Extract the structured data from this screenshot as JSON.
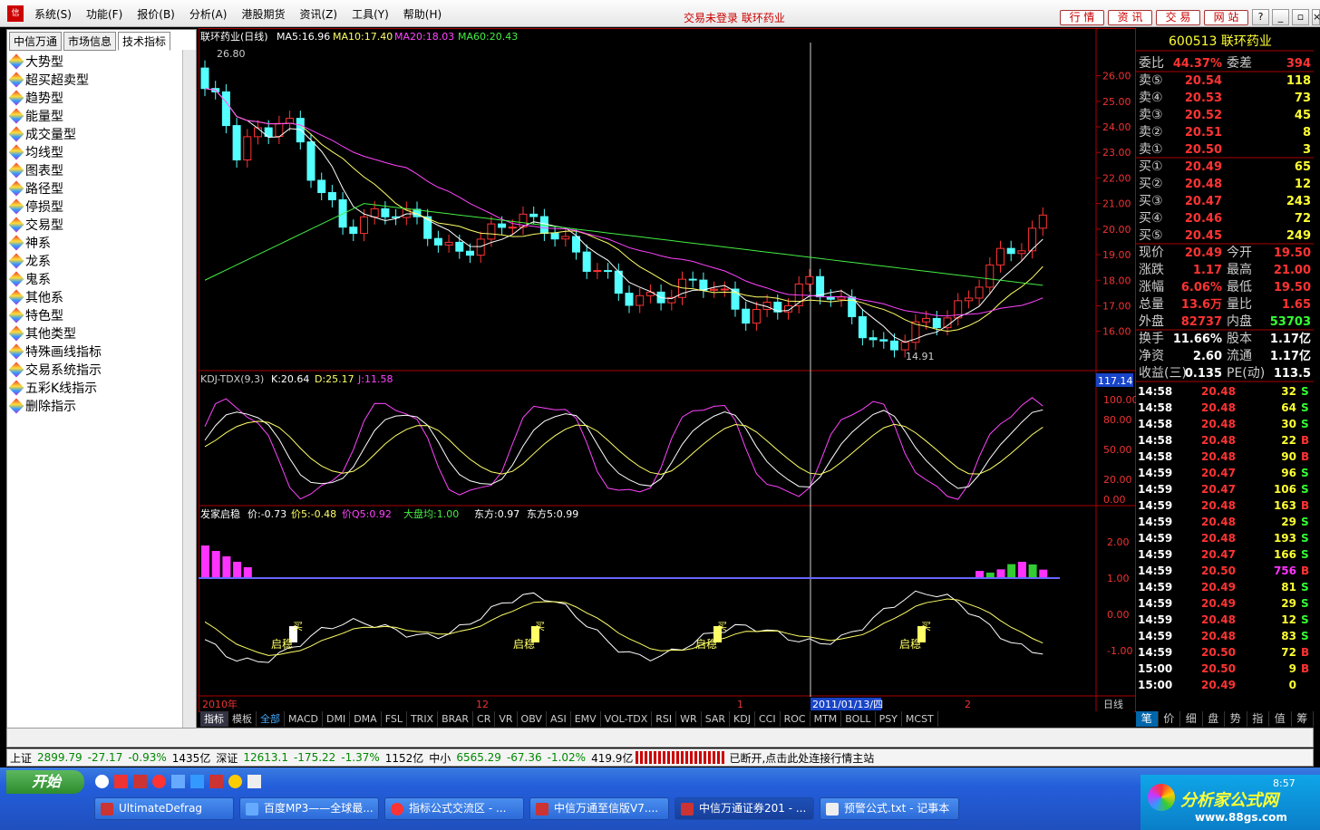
{
  "title_bar": {
    "menus": [
      "系统(S)",
      "功能(F)",
      "报价(B)",
      "分析(A)",
      "港股期货",
      "资讯(Z)",
      "工具(Y)",
      "帮助(H)"
    ],
    "status": "交易未登录",
    "stock": "联环药业",
    "nav": [
      "行 情",
      "资 讯",
      "交 易",
      "网 站"
    ],
    "win_buttons": [
      "?",
      "_",
      "▫",
      "×"
    ]
  },
  "left_panel": {
    "tabs": [
      "中信万通",
      "市场信息",
      "技术指标"
    ],
    "items": [
      "大势型",
      "超买超卖型",
      "趋势型",
      "能量型",
      "成交量型",
      "均线型",
      "图表型",
      "路径型",
      "停损型",
      "交易型",
      "神系",
      "龙系",
      "鬼系",
      "其他系",
      "特色型",
      "其他类型",
      "特殊画线指标",
      "交易系统指示",
      "五彩K线指示",
      "删除指示"
    ]
  },
  "main_chart": {
    "header": {
      "name": "联环药业(日线)",
      "ma5": "MA5:16.96",
      "ma10": "MA10:17.40",
      "ma20": "MA20:18.03",
      "ma60": "MA60:20.43"
    },
    "high_label": "26.80",
    "low_label": "14.91",
    "y_ticks": [
      "26.00",
      "25.00",
      "24.00",
      "23.00",
      "22.00",
      "21.00",
      "20.00",
      "19.00",
      "18.00",
      "17.00",
      "16.00"
    ]
  },
  "kdj": {
    "title": "KDJ-TDX(9,3)",
    "k": "K:20.64",
    "d": "D:25.17",
    "j": "J:11.58",
    "value_box": "117.14",
    "y_ticks": [
      "100.00",
      "80.00",
      "50.00",
      "20.00",
      "0.00"
    ]
  },
  "indicator": {
    "title": "发家启稳",
    "p1": "价:-0.73",
    "p2": "价5:-0.48",
    "p3": "价Q5:0.92",
    "p4": "大盘均:1.00",
    "p5": "东方:0.97",
    "p6": "东方5:0.99",
    "y_ticks": [
      "2.00",
      "1.00",
      "0.00",
      "-1.00"
    ],
    "signals": [
      "启稳",
      "启稳",
      "启稳",
      "启稳"
    ],
    "buy_labels": [
      "买",
      "买",
      "买",
      "买"
    ]
  },
  "x_axis": {
    "labels": [
      "2010年",
      "12",
      "1",
      "2011/01/13/四",
      "2"
    ],
    "period": "日线"
  },
  "bottom_tabs": [
    "指标",
    "模板",
    "全部",
    "MACD",
    "DMI",
    "DMA",
    "FSL",
    "TRIX",
    "BRAR",
    "CR",
    "VR",
    "OBV",
    "ASI",
    "EMV",
    "VOL-TDX",
    "RSI",
    "WR",
    "SAR",
    "KDJ",
    "CCI",
    "ROC",
    "MTM",
    "BOLL",
    "PSY",
    "MCST"
  ],
  "quote": {
    "code_name": "600513 联环药业",
    "webi": "委比",
    "webi_v": "44.37%",
    "weicha": "委差",
    "weicha_v": "394",
    "sell": [
      {
        "l": "卖⑤",
        "p": "20.54",
        "v": "118"
      },
      {
        "l": "卖④",
        "p": "20.53",
        "v": "73"
      },
      {
        "l": "卖③",
        "p": "20.52",
        "v": "45"
      },
      {
        "l": "卖②",
        "p": "20.51",
        "v": "8"
      },
      {
        "l": "卖①",
        "p": "20.50",
        "v": "3"
      }
    ],
    "buy": [
      {
        "l": "买①",
        "p": "20.49",
        "v": "65"
      },
      {
        "l": "买②",
        "p": "20.48",
        "v": "12"
      },
      {
        "l": "买③",
        "p": "20.47",
        "v": "243"
      },
      {
        "l": "买④",
        "p": "20.46",
        "v": "72"
      },
      {
        "l": "买⑤",
        "p": "20.45",
        "v": "249"
      }
    ],
    "stats": [
      [
        "现价",
        "20.49",
        "今开",
        "19.50"
      ],
      [
        "涨跌",
        "1.17",
        "最高",
        "21.00"
      ],
      [
        "涨幅",
        "6.06%",
        "最低",
        "19.50"
      ],
      [
        "总量",
        "13.6万",
        "量比",
        "1.65"
      ],
      [
        "外盘",
        "82737",
        "内盘",
        "53703"
      ]
    ],
    "stats2": [
      [
        "换手",
        "11.66%",
        "股本",
        "1.17亿"
      ],
      [
        "净资",
        "2.60",
        "流通",
        "1.17亿"
      ],
      [
        "收益(三)",
        "0.135",
        "PE(动)",
        "113.5"
      ]
    ],
    "ticks": [
      [
        "14:58",
        "20.48",
        "32",
        "S"
      ],
      [
        "14:58",
        "20.48",
        "64",
        "S"
      ],
      [
        "14:58",
        "20.48",
        "30",
        "S"
      ],
      [
        "14:58",
        "20.48",
        "22",
        "B"
      ],
      [
        "14:58",
        "20.48",
        "90",
        "B"
      ],
      [
        "14:59",
        "20.47",
        "96",
        "S"
      ],
      [
        "14:59",
        "20.47",
        "106",
        "S"
      ],
      [
        "14:59",
        "20.48",
        "163",
        "B"
      ],
      [
        "14:59",
        "20.48",
        "29",
        "S"
      ],
      [
        "14:59",
        "20.48",
        "193",
        "S"
      ],
      [
        "14:59",
        "20.47",
        "166",
        "S"
      ],
      [
        "14:59",
        "20.50",
        "756",
        "B"
      ],
      [
        "14:59",
        "20.49",
        "81",
        "S"
      ],
      [
        "14:59",
        "20.49",
        "29",
        "S"
      ],
      [
        "14:59",
        "20.48",
        "12",
        "S"
      ],
      [
        "14:59",
        "20.48",
        "83",
        "S"
      ],
      [
        "14:59",
        "20.50",
        "72",
        "B"
      ],
      [
        "15:00",
        "20.50",
        "9",
        "B"
      ],
      [
        "15:00",
        "20.49",
        "0",
        ""
      ]
    ],
    "tabs": [
      "笔",
      "价",
      "细",
      "盘",
      "势",
      "指",
      "值",
      "筹"
    ]
  },
  "status_bar": {
    "sh": "上证",
    "sh_v": "2899.79",
    "sh_c": "-27.17",
    "sh_p": "-0.93%",
    "sh_a": "1435亿",
    "sz": "深证",
    "sz_v": "12613.1",
    "sz_c": "-175.22",
    "sz_p": "-1.37%",
    "sz_a": "1152亿",
    "zx": "中小",
    "zx_v": "6565.29",
    "zx_c": "-67.36",
    "zx_p": "-1.02%",
    "zx_a": "419.9亿",
    "msg": "已断开,点击此处连接行情主站"
  },
  "taskbar": {
    "start": "开始",
    "items": [
      "UltimateDefrag",
      "百度MP3——全球最...",
      "指标公式交流区 - ...",
      "中信万通至信版V7....",
      "中信万通证券201 - ...",
      "预警公式.txt - 记事本"
    ],
    "clock": "8:57",
    "watermark": "分析家公式网",
    "watermark_url": "www.88gs.com"
  }
}
